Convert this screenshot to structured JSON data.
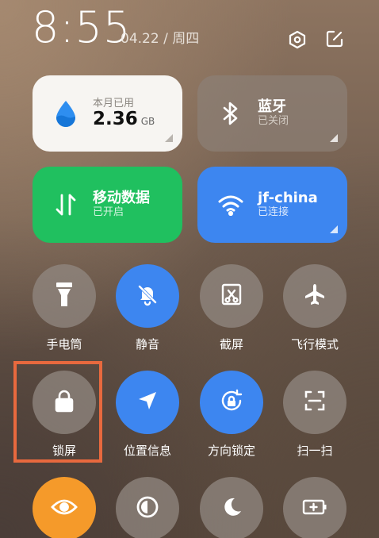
{
  "header": {
    "time": "8:55",
    "date": "04.22 / 周四"
  },
  "tiles": {
    "data_usage": {
      "label": "本月已用",
      "value": "2.36",
      "unit": "GB",
      "icon": "water-drop-icon"
    },
    "bluetooth": {
      "title": "蓝牙",
      "status": "已关闭",
      "icon": "bluetooth-icon"
    },
    "mobile_data": {
      "title": "移动数据",
      "status": "已开启",
      "icon": "data-arrows-icon"
    },
    "wifi": {
      "title": "jf-china",
      "status": "已连接",
      "icon": "wifi-icon"
    }
  },
  "toggles": [
    {
      "label": "手电筒",
      "icon": "flashlight-icon",
      "state": "off"
    },
    {
      "label": "静音",
      "icon": "bell-off-icon",
      "state": "on"
    },
    {
      "label": "截屏",
      "icon": "screenshot-icon",
      "state": "off"
    },
    {
      "label": "飞行模式",
      "icon": "airplane-icon",
      "state": "off"
    },
    {
      "label": "锁屏",
      "icon": "lock-icon",
      "state": "off"
    },
    {
      "label": "位置信息",
      "icon": "location-arrow-icon",
      "state": "on"
    },
    {
      "label": "方向锁定",
      "icon": "rotation-lock-icon",
      "state": "on"
    },
    {
      "label": "扫一扫",
      "icon": "scan-icon",
      "state": "off"
    },
    {
      "label": "",
      "icon": "eye-icon",
      "state": "on"
    },
    {
      "label": "",
      "icon": "contrast-icon",
      "state": "off"
    },
    {
      "label": "",
      "icon": "moon-icon",
      "state": "off"
    },
    {
      "label": "",
      "icon": "battery-saver-icon",
      "state": "off"
    }
  ],
  "colors": {
    "accent_blue": "#3d86f0",
    "accent_green": "#20c05f",
    "accent_orange": "#f59a2a",
    "highlight": "#e8693e"
  }
}
